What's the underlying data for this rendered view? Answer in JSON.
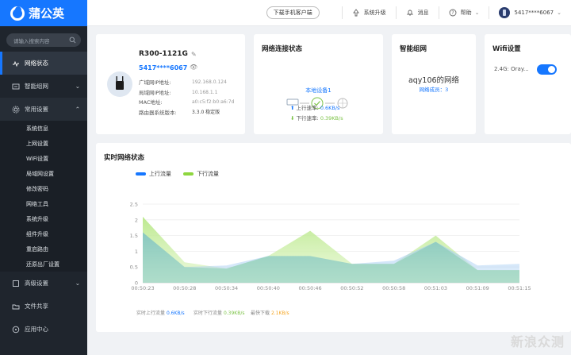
{
  "brand": {
    "name": "蒲公英"
  },
  "topbar": {
    "download": "下载手机客户端",
    "upgrade": "系统升级",
    "messages": "消息",
    "help": "帮助",
    "account": "5417****6067"
  },
  "sidebar": {
    "search_placeholder": "请输入搜索内容",
    "status": "网络状态",
    "smart": "智能组网",
    "common": "常用设置",
    "sub": [
      "系统信息",
      "上网设置",
      "WiFi设置",
      "局域网设置",
      "修改密码",
      "网络工具",
      "系统升级",
      "组件升级",
      "重启路由",
      "还原出厂设置"
    ],
    "advanced": "高级设置",
    "fileshare": "文件共享",
    "appcenter": "应用中心"
  },
  "device": {
    "model": "R300-1121G",
    "sn": "5417****6067",
    "labels": [
      "广域网IP地址:",
      "局域网IP地址:",
      "MAC地址:",
      "路由器系统版本:"
    ],
    "values": [
      "192.168.0.124",
      "10.168.1.1",
      "a0:c5:f2:b0:a6:7d",
      "3.3.0 稳定版"
    ]
  },
  "connection": {
    "title": "网络连接状态",
    "local": "本地设备1",
    "up_label": "上行速率:",
    "up_value": "0.6KB/s",
    "down_label": "下行速率:",
    "down_value": "0.39KB/s"
  },
  "smartnet": {
    "title": "智能组网",
    "name": "aqy106的网络",
    "members": "网络成员：3"
  },
  "wifi": {
    "title": "Wifi设置",
    "band": "2.4G:",
    "ssid": "Oray...",
    "enabled": true
  },
  "realtime": {
    "title": "实时网络状态",
    "legend_up": "上行流量",
    "legend_down": "下行流量",
    "foot_up_label": "实时上行流量",
    "foot_up_value": "0.6KB/s",
    "foot_down_label": "实时下行流量",
    "foot_down_value": "0.39KB/s",
    "foot_peak_label": "最快下载",
    "foot_peak_value": "2.1KB/s"
  },
  "colors": {
    "accent": "#1677ff",
    "up": "#6aaef5",
    "down": "#8ed63e",
    "sidebar": "#1f252d"
  },
  "chart_data": {
    "type": "area",
    "x": [
      "00:50:23",
      "00:50:28",
      "00:50:34",
      "00:50:40",
      "00:50:46",
      "00:50:52",
      "00:50:58",
      "00:51:03",
      "00:51:09",
      "00:51:15"
    ],
    "ylim": [
      0,
      2.5
    ],
    "yticks": [
      "2.5",
      "2",
      "1.5",
      "1",
      "0.5",
      "0"
    ],
    "series": [
      {
        "name": "上行流量",
        "color": "#6aaef5",
        "values": [
          1.6,
          0.5,
          0.55,
          0.85,
          0.85,
          0.6,
          0.7,
          1.3,
          0.55,
          0.6
        ]
      },
      {
        "name": "下行流量",
        "color": "#8ed63e",
        "values": [
          2.1,
          0.65,
          0.45,
          0.85,
          1.65,
          0.6,
          0.6,
          1.5,
          0.4,
          0.4
        ]
      }
    ]
  }
}
